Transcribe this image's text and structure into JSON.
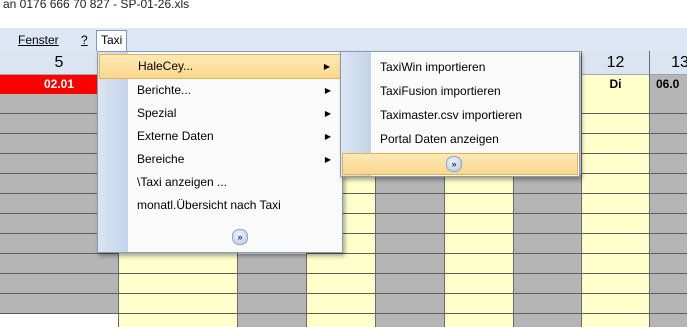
{
  "title_text": "an 0176 666 70 827 - SP-01-26.xls",
  "menubar": {
    "fenster": "Fenster",
    "help": "?",
    "taxi": "Taxi"
  },
  "grid": {
    "col5_header": "5",
    "col5_day": "02.01",
    "col12_header": "12",
    "col12_day": "Di",
    "col13_header": "13",
    "col13_day": "06.0"
  },
  "taxi_menu": {
    "items": [
      {
        "label": "HaleCey...",
        "submenu": true
      },
      {
        "label": "Berichte...",
        "submenu": true
      },
      {
        "label": "Spezial",
        "submenu": true
      },
      {
        "label": "Externe Daten",
        "submenu": true
      },
      {
        "label": "Bereiche",
        "submenu": true
      },
      {
        "label": "\\Taxi anzeigen ...",
        "submenu": false
      },
      {
        "label": "monatl.Übersicht nach Taxi",
        "submenu": false
      }
    ],
    "expand_glyph": "»"
  },
  "halecey_submenu": {
    "items": [
      {
        "label": "TaxiWin importieren"
      },
      {
        "label": "TaxiFusion importieren"
      },
      {
        "label": "Taximaster.csv importieren"
      },
      {
        "label": "Portal Daten anzeigen"
      }
    ],
    "expand_glyph": "»"
  },
  "colors": {
    "red_header": "#ff0000",
    "yellow_cell": "#ffffcc",
    "gray_cell": "#b5b5b5",
    "header_bg": "#dbe5f1",
    "highlight": "#fbd78d"
  },
  "icons": {
    "submenu_arrow": "▶",
    "expand": "chevron-double-down-icon"
  }
}
